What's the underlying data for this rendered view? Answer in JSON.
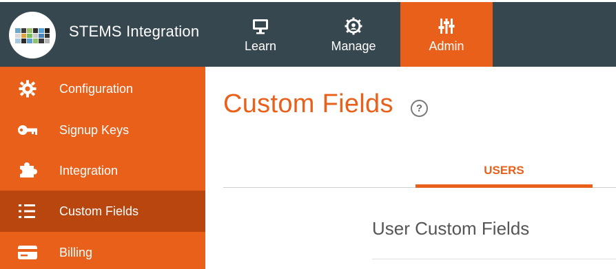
{
  "header": {
    "app_title": "STEMS Integration",
    "nav": [
      {
        "label": "Learn",
        "icon": "monitor-icon"
      },
      {
        "label": "Manage",
        "icon": "gear-icon"
      },
      {
        "label": "Admin",
        "icon": "sliders-icon",
        "active": true
      }
    ]
  },
  "sidebar": {
    "items": [
      {
        "label": "Configuration",
        "icon": "gear-icon"
      },
      {
        "label": "Signup Keys",
        "icon": "key-icon"
      },
      {
        "label": "Integration",
        "icon": "puzzle-icon"
      },
      {
        "label": "Custom Fields",
        "icon": "list-icon",
        "active": true
      },
      {
        "label": "Billing",
        "icon": "credit-card-icon"
      }
    ]
  },
  "main": {
    "title": "Custom Fields",
    "help_symbol": "?",
    "tabs": [
      {
        "label": "USERS",
        "active": true
      }
    ],
    "section_title": "User Custom Fields"
  },
  "colors": {
    "accent": "#e8601a",
    "accent_dark": "#b9460f",
    "header_bg": "#37474f"
  }
}
